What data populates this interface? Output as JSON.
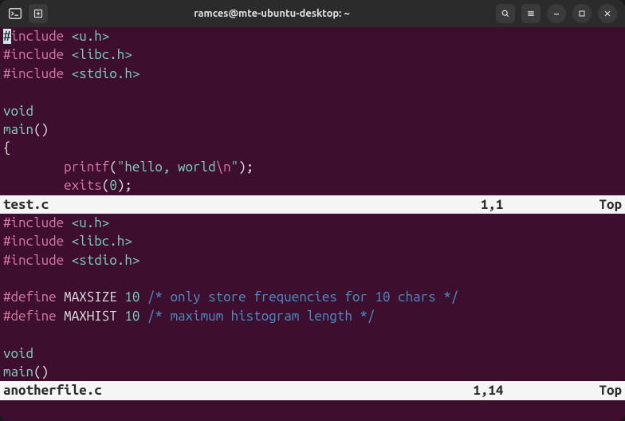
{
  "titlebar": {
    "title": "ramces@mte-ubuntu-desktop: ~"
  },
  "panes": [
    {
      "lines": [
        [
          {
            "text": "#",
            "cls": "cursor"
          },
          {
            "text": "include ",
            "cls": "kw-pre"
          },
          {
            "text": "<u.h>",
            "cls": "hdr"
          }
        ],
        [
          {
            "text": "#include ",
            "cls": "kw-pre"
          },
          {
            "text": "<libc.h>",
            "cls": "hdr"
          }
        ],
        [
          {
            "text": "#include ",
            "cls": "kw-pre"
          },
          {
            "text": "<stdio.h>",
            "cls": "hdr"
          }
        ],
        [],
        [
          {
            "text": "void",
            "cls": "type"
          }
        ],
        [
          {
            "text": "main",
            "cls": "func"
          },
          {
            "text": "()",
            "cls": "punct"
          }
        ],
        [
          {
            "text": "{",
            "cls": "punct"
          }
        ],
        [
          {
            "text": "        ",
            "cls": "punct"
          },
          {
            "text": "printf",
            "cls": "call"
          },
          {
            "text": "(",
            "cls": "punct"
          },
          {
            "text": "\"hello, world",
            "cls": "str"
          },
          {
            "text": "\\n",
            "cls": "esc"
          },
          {
            "text": "\"",
            "cls": "str"
          },
          {
            "text": ");",
            "cls": "punct"
          }
        ],
        [
          {
            "text": "        ",
            "cls": "punct"
          },
          {
            "text": "exits",
            "cls": "call"
          },
          {
            "text": "(",
            "cls": "punct"
          },
          {
            "text": "0",
            "cls": "num"
          },
          {
            "text": ");",
            "cls": "punct"
          }
        ]
      ],
      "status": {
        "filename": "test.c",
        "cursor": "1,1",
        "scroll": "Top"
      }
    },
    {
      "lines": [
        [
          {
            "text": "#include ",
            "cls": "kw-pre"
          },
          {
            "text": "<u.h>",
            "cls": "hdr"
          }
        ],
        [
          {
            "text": "#include ",
            "cls": "kw-pre"
          },
          {
            "text": "<libc.h>",
            "cls": "hdr"
          }
        ],
        [
          {
            "text": "#include ",
            "cls": "kw-pre"
          },
          {
            "text": "<stdio.h>",
            "cls": "hdr"
          }
        ],
        [],
        [
          {
            "text": "#define ",
            "cls": "kw-pre"
          },
          {
            "text": "MAXSIZE ",
            "cls": "macro"
          },
          {
            "text": "10",
            "cls": "num"
          },
          {
            "text": " ",
            "cls": "punct"
          },
          {
            "text": "/* only store frequencies for 10 chars */",
            "cls": "comment"
          }
        ],
        [
          {
            "text": "#define ",
            "cls": "kw-pre"
          },
          {
            "text": "MAXHIST ",
            "cls": "macro"
          },
          {
            "text": "10",
            "cls": "num"
          },
          {
            "text": " ",
            "cls": "punct"
          },
          {
            "text": "/* maximum histogram length */",
            "cls": "comment"
          }
        ],
        [],
        [
          {
            "text": "void",
            "cls": "type"
          }
        ],
        [
          {
            "text": "main",
            "cls": "func"
          },
          {
            "text": "()",
            "cls": "punct"
          }
        ]
      ],
      "status": {
        "filename": "anotherfile.c",
        "cursor": "1,14",
        "scroll": "Top"
      }
    }
  ]
}
